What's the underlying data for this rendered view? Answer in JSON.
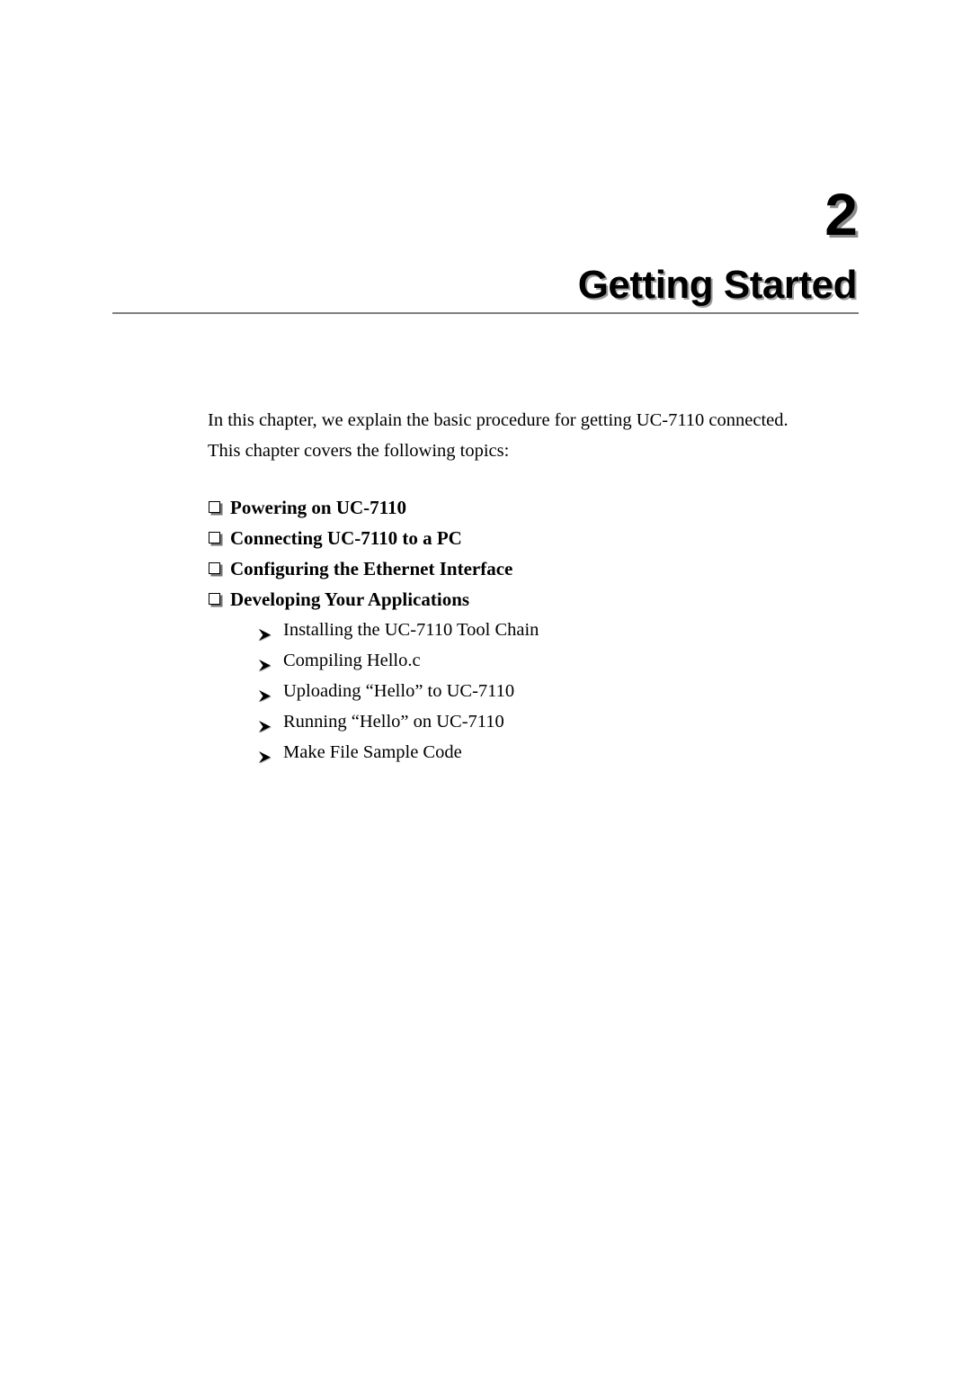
{
  "chapter": {
    "number": "2",
    "title": "Getting Started"
  },
  "intro": {
    "line1": "In this chapter, we explain the basic procedure for getting UC-7110 connected.",
    "line2": "This chapter covers the following topics:"
  },
  "topics": [
    {
      "label": "Powering on UC-7110",
      "bullet": "square-bullet-icon"
    },
    {
      "label": "Connecting UC-7110 to a PC",
      "bullet": "square-bullet-icon"
    },
    {
      "label": "Configuring the Ethernet Interface",
      "bullet": "square-bullet-icon"
    },
    {
      "label": "Developing Your Applications",
      "bullet": "square-bullet-icon"
    }
  ],
  "subtopics": [
    {
      "label": "Installing the UC-7110 Tool Chain",
      "bullet": "arrow-bullet-icon"
    },
    {
      "label": "Compiling Hello.c",
      "bullet": "arrow-bullet-icon"
    },
    {
      "label": "Uploading “Hello” to UC-7110",
      "bullet": "arrow-bullet-icon"
    },
    {
      "label": "Running “Hello” on UC-7110",
      "bullet": "arrow-bullet-icon"
    },
    {
      "label": "Make File Sample Code",
      "bullet": "arrow-bullet-icon"
    }
  ],
  "colors": {
    "text": "#000000",
    "rule": "#808080",
    "page": "#ffffff"
  }
}
